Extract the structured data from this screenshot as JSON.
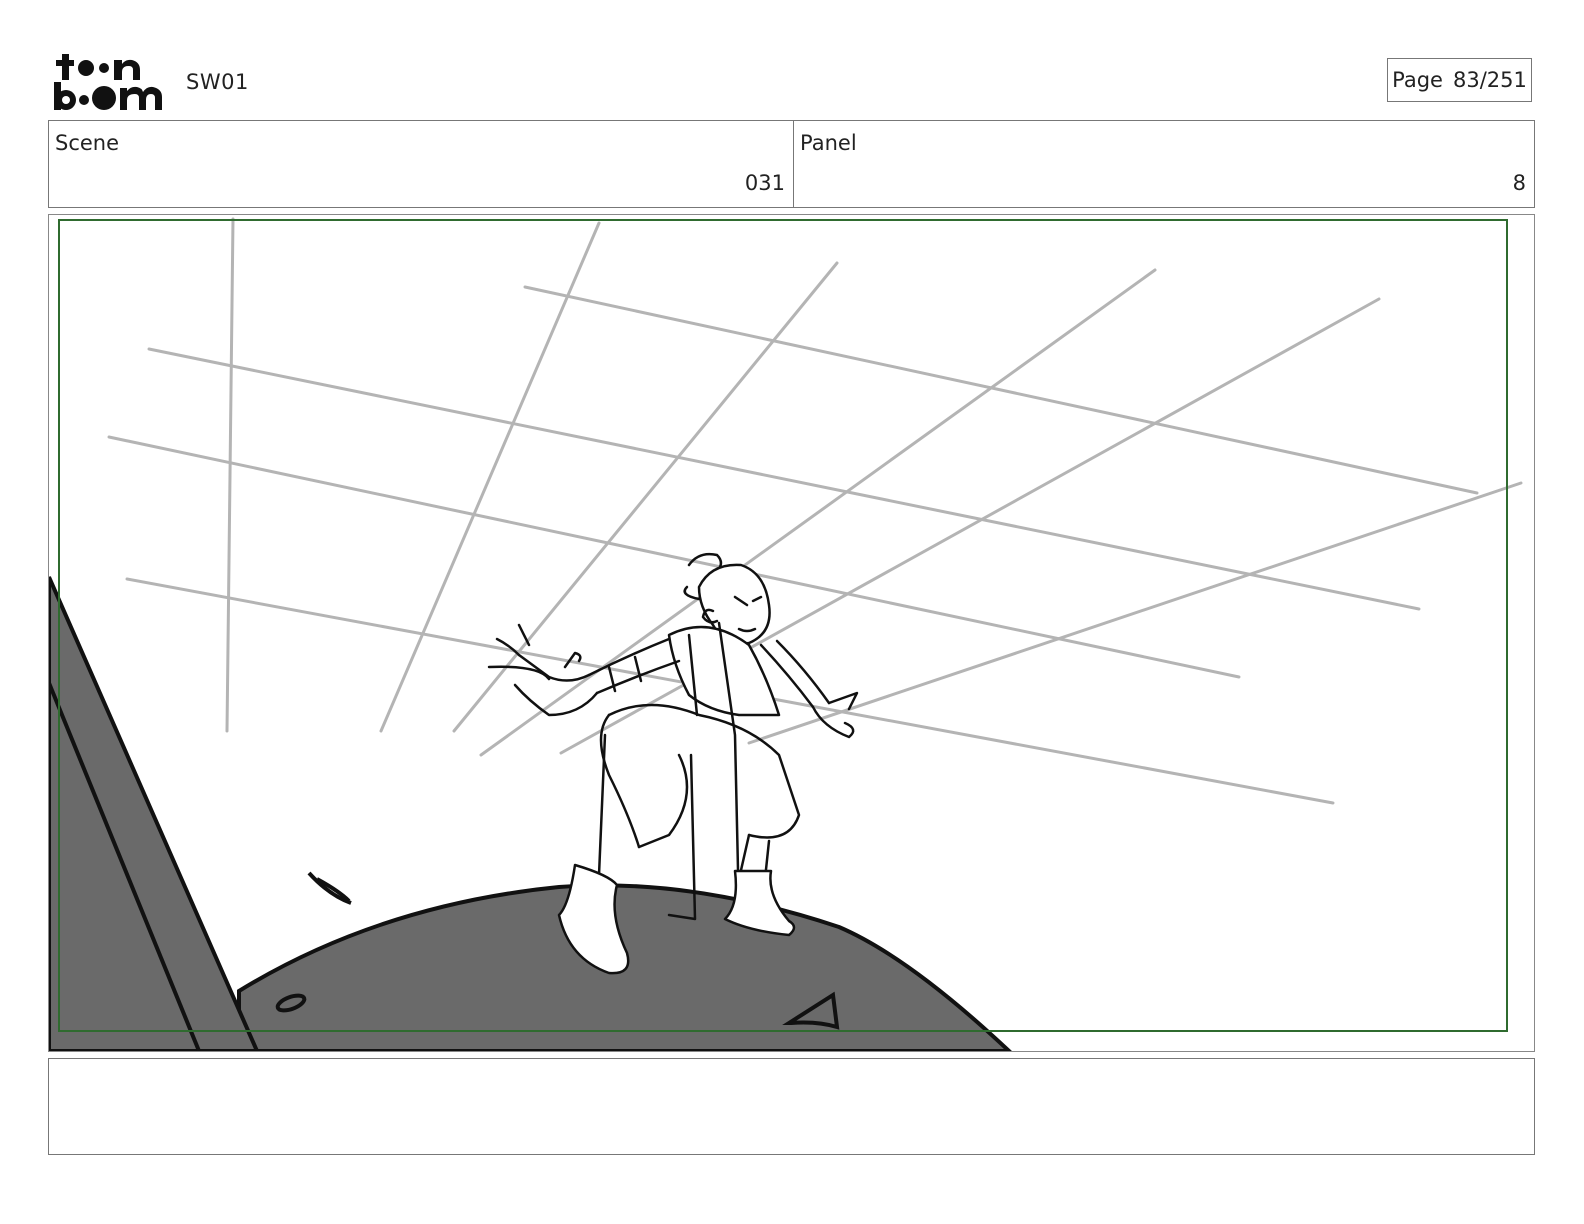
{
  "header": {
    "logo_text": "toonboom",
    "project": "SW01",
    "page_label": "Page",
    "page_value": "83/251"
  },
  "info": {
    "scene_label": "Scene",
    "scene_value": "031",
    "panel_label": "Panel",
    "panel_value": "8"
  },
  "colors": {
    "safe_frame": "#2f6b2f",
    "ground_fill": "#6a6a6a",
    "grid_lines": "#b4b4b4",
    "ink": "#111111"
  },
  "notes": {
    "text": ""
  }
}
